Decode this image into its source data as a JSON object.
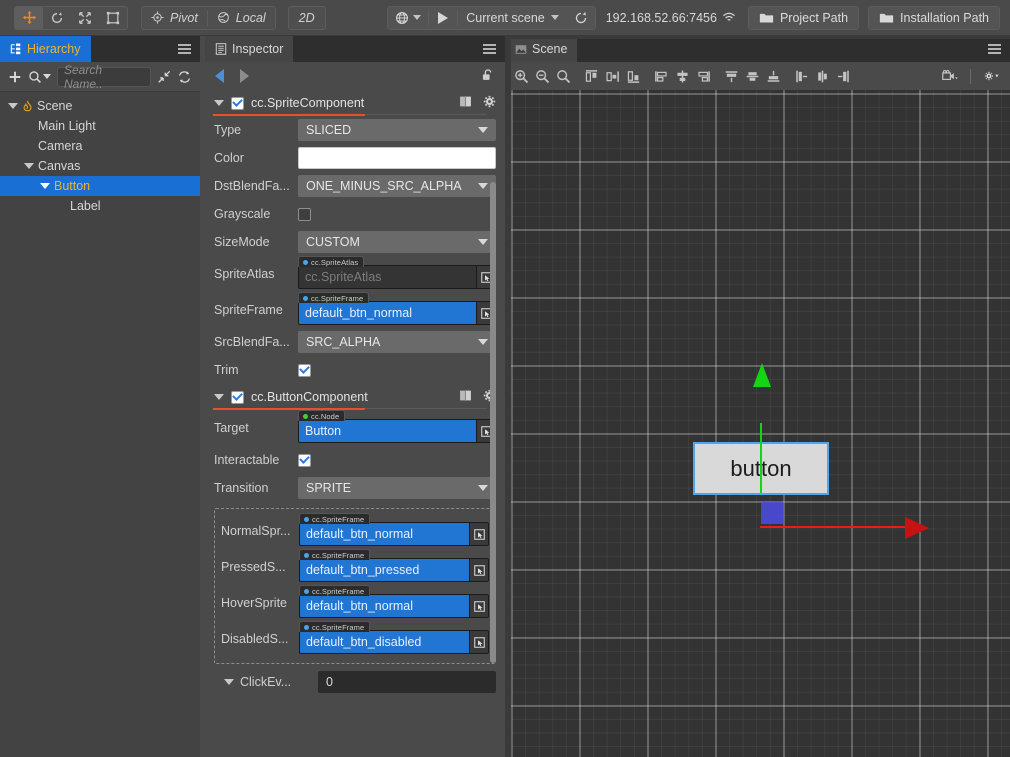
{
  "toolbar": {
    "transform_tools": [
      {
        "name": "move-tool",
        "glyph": "✥",
        "active": true
      },
      {
        "name": "rotate-tool",
        "glyph": "↻",
        "active": false
      },
      {
        "name": "scale-tool",
        "glyph": "⤢",
        "active": false
      },
      {
        "name": "rect-tool",
        "glyph": "⬚",
        "active": false
      }
    ],
    "pivot_label": "Pivot",
    "coord_label": "Local",
    "dimension_label": "2D",
    "browser_icon": "globe-icon",
    "play_icon": "play-icon",
    "scene_selector": "Current scene",
    "refresh_icon": "refresh-icon",
    "server_address": "192.168.52.66:7456",
    "wifi_icon": "wifi-icon",
    "project_path_label": "Project Path",
    "installation_path_label": "Installation Path"
  },
  "hierarchy": {
    "tab_label": "Hierarchy",
    "add_icon": "plus-icon",
    "search_icon": "search-icon",
    "search_placeholder": "Search Name..",
    "collapse_icon": "collapse-icon",
    "sync_icon": "sync-icon",
    "menu_icon": "hamburger-icon",
    "nodes": [
      {
        "label": "Scene",
        "depth": 0,
        "expandable": true,
        "selected": false,
        "icon": "flame-icon"
      },
      {
        "label": "Main Light",
        "depth": 1,
        "expandable": false,
        "selected": false,
        "icon": ""
      },
      {
        "label": "Camera",
        "depth": 1,
        "expandable": false,
        "selected": false,
        "icon": ""
      },
      {
        "label": "Canvas",
        "depth": 1,
        "expandable": true,
        "selected": false,
        "icon": ""
      },
      {
        "label": "Button",
        "depth": 2,
        "expandable": true,
        "selected": true,
        "icon": ""
      },
      {
        "label": "Label",
        "depth": 3,
        "expandable": false,
        "selected": false,
        "icon": ""
      }
    ]
  },
  "inspector": {
    "tab_label": "Inspector",
    "back_icon": "arrow-left-icon",
    "forward_icon": "arrow-right-icon",
    "lock_icon": "unlock-icon",
    "menu_icon": "hamburger-icon",
    "components": [
      {
        "title": "cc.SpriteComponent",
        "enabled": true,
        "help_icon": "book-icon",
        "settings_icon": "gear-icon",
        "properties": [
          {
            "label": "Type",
            "kind": "dropdown",
            "value": "SLICED"
          },
          {
            "label": "Color",
            "kind": "color",
            "value": "#FFFFFF"
          },
          {
            "label": "DstBlendFa...",
            "kind": "dropdown",
            "value": "ONE_MINUS_SRC_ALPHA"
          },
          {
            "label": "Grayscale",
            "kind": "checkbox",
            "value": false
          },
          {
            "label": "SizeMode",
            "kind": "dropdown",
            "value": "CUSTOM"
          },
          {
            "label": "SpriteAtlas",
            "kind": "asset",
            "value": "cc.SpriteAtlas",
            "type": "cc.SpriteAtlas",
            "empty": true,
            "dot_color": "#4aa3e8"
          },
          {
            "label": "SpriteFrame",
            "kind": "asset",
            "value": "default_btn_normal",
            "type": "cc.SpriteFrame",
            "empty": false,
            "dot_color": "#4aa3e8"
          },
          {
            "label": "SrcBlendFa...",
            "kind": "dropdown",
            "value": "SRC_ALPHA"
          },
          {
            "label": "Trim",
            "kind": "checkbox",
            "value": true
          }
        ]
      },
      {
        "title": "cc.ButtonComponent",
        "enabled": true,
        "help_icon": "book-icon",
        "settings_icon": "gear-icon",
        "properties": [
          {
            "label": "Target",
            "kind": "asset",
            "value": "Button",
            "type": "cc.Node",
            "empty": false,
            "dot_color": "#3ad13a"
          },
          {
            "label": "Interactable",
            "kind": "checkbox",
            "value": true
          },
          {
            "label": "Transition",
            "kind": "dropdown",
            "value": "SPRITE"
          }
        ],
        "sprite_group": [
          {
            "label": "NormalSpr...",
            "type": "cc.SpriteFrame",
            "value": "default_btn_normal",
            "dot_color": "#4aa3e8"
          },
          {
            "label": "PressedS...",
            "type": "cc.SpriteFrame",
            "value": "default_btn_pressed",
            "dot_color": "#4aa3e8"
          },
          {
            "label": "HoverSprite",
            "type": "cc.SpriteFrame",
            "value": "default_btn_normal",
            "dot_color": "#4aa3e8"
          },
          {
            "label": "DisabledS...",
            "type": "cc.SpriteFrame",
            "value": "default_btn_disabled",
            "dot_color": "#4aa3e8"
          }
        ],
        "click_events": {
          "label": "ClickEv...",
          "value": "0",
          "expand_icon": "triangle-down-icon"
        }
      }
    ]
  },
  "scene": {
    "tab_label": "Scene",
    "menu_icon": "hamburger-icon",
    "tools": [
      {
        "name": "zoom-in-icon"
      },
      {
        "name": "zoom-out-icon"
      },
      {
        "name": "zoom-fit-icon"
      },
      {
        "name": "align-top-icon"
      },
      {
        "name": "align-middle-h-icon"
      },
      {
        "name": "align-bottom-icon"
      },
      {
        "name": "align-left-icon"
      },
      {
        "name": "align-center-v-icon"
      },
      {
        "name": "align-right-icon"
      },
      {
        "name": "distribute-top-icon"
      },
      {
        "name": "distribute-middle-icon"
      },
      {
        "name": "distribute-bottom-icon"
      },
      {
        "name": "distribute-left-icon"
      },
      {
        "name": "distribute-center-icon"
      },
      {
        "name": "distribute-right-icon"
      }
    ],
    "camera_icon": "camera-icon",
    "gear_icon": "gear-icon",
    "node_label": "button",
    "gizmo": {
      "y_axis_color": "#12d612",
      "x_axis_color": "#e81c1c",
      "center_color": "#4b4be0"
    },
    "selection_outline_color": "#4ea6f0",
    "node_fill_color": "#d9d9d9"
  }
}
